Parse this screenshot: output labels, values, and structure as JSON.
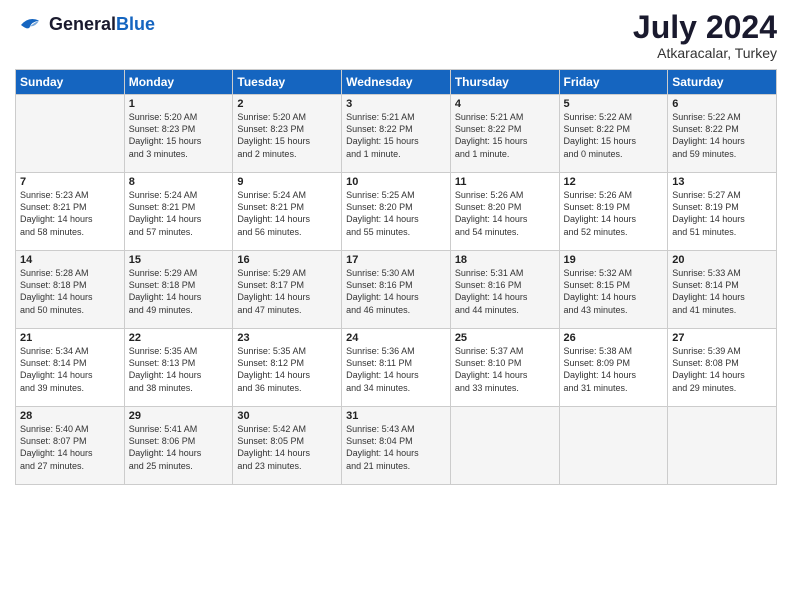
{
  "header": {
    "logo_general": "General",
    "logo_blue": "Blue",
    "month_title": "July 2024",
    "subtitle": "Atkaracalar, Turkey"
  },
  "weekdays": [
    "Sunday",
    "Monday",
    "Tuesday",
    "Wednesday",
    "Thursday",
    "Friday",
    "Saturday"
  ],
  "weeks": [
    [
      {
        "day": "",
        "info": ""
      },
      {
        "day": "1",
        "info": "Sunrise: 5:20 AM\nSunset: 8:23 PM\nDaylight: 15 hours\nand 3 minutes."
      },
      {
        "day": "2",
        "info": "Sunrise: 5:20 AM\nSunset: 8:23 PM\nDaylight: 15 hours\nand 2 minutes."
      },
      {
        "day": "3",
        "info": "Sunrise: 5:21 AM\nSunset: 8:22 PM\nDaylight: 15 hours\nand 1 minute."
      },
      {
        "day": "4",
        "info": "Sunrise: 5:21 AM\nSunset: 8:22 PM\nDaylight: 15 hours\nand 1 minute."
      },
      {
        "day": "5",
        "info": "Sunrise: 5:22 AM\nSunset: 8:22 PM\nDaylight: 15 hours\nand 0 minutes."
      },
      {
        "day": "6",
        "info": "Sunrise: 5:22 AM\nSunset: 8:22 PM\nDaylight: 14 hours\nand 59 minutes."
      }
    ],
    [
      {
        "day": "7",
        "info": "Sunrise: 5:23 AM\nSunset: 8:21 PM\nDaylight: 14 hours\nand 58 minutes."
      },
      {
        "day": "8",
        "info": "Sunrise: 5:24 AM\nSunset: 8:21 PM\nDaylight: 14 hours\nand 57 minutes."
      },
      {
        "day": "9",
        "info": "Sunrise: 5:24 AM\nSunset: 8:21 PM\nDaylight: 14 hours\nand 56 minutes."
      },
      {
        "day": "10",
        "info": "Sunrise: 5:25 AM\nSunset: 8:20 PM\nDaylight: 14 hours\nand 55 minutes."
      },
      {
        "day": "11",
        "info": "Sunrise: 5:26 AM\nSunset: 8:20 PM\nDaylight: 14 hours\nand 54 minutes."
      },
      {
        "day": "12",
        "info": "Sunrise: 5:26 AM\nSunset: 8:19 PM\nDaylight: 14 hours\nand 52 minutes."
      },
      {
        "day": "13",
        "info": "Sunrise: 5:27 AM\nSunset: 8:19 PM\nDaylight: 14 hours\nand 51 minutes."
      }
    ],
    [
      {
        "day": "14",
        "info": "Sunrise: 5:28 AM\nSunset: 8:18 PM\nDaylight: 14 hours\nand 50 minutes."
      },
      {
        "day": "15",
        "info": "Sunrise: 5:29 AM\nSunset: 8:18 PM\nDaylight: 14 hours\nand 49 minutes."
      },
      {
        "day": "16",
        "info": "Sunrise: 5:29 AM\nSunset: 8:17 PM\nDaylight: 14 hours\nand 47 minutes."
      },
      {
        "day": "17",
        "info": "Sunrise: 5:30 AM\nSunset: 8:16 PM\nDaylight: 14 hours\nand 46 minutes."
      },
      {
        "day": "18",
        "info": "Sunrise: 5:31 AM\nSunset: 8:16 PM\nDaylight: 14 hours\nand 44 minutes."
      },
      {
        "day": "19",
        "info": "Sunrise: 5:32 AM\nSunset: 8:15 PM\nDaylight: 14 hours\nand 43 minutes."
      },
      {
        "day": "20",
        "info": "Sunrise: 5:33 AM\nSunset: 8:14 PM\nDaylight: 14 hours\nand 41 minutes."
      }
    ],
    [
      {
        "day": "21",
        "info": "Sunrise: 5:34 AM\nSunset: 8:14 PM\nDaylight: 14 hours\nand 39 minutes."
      },
      {
        "day": "22",
        "info": "Sunrise: 5:35 AM\nSunset: 8:13 PM\nDaylight: 14 hours\nand 38 minutes."
      },
      {
        "day": "23",
        "info": "Sunrise: 5:35 AM\nSunset: 8:12 PM\nDaylight: 14 hours\nand 36 minutes."
      },
      {
        "day": "24",
        "info": "Sunrise: 5:36 AM\nSunset: 8:11 PM\nDaylight: 14 hours\nand 34 minutes."
      },
      {
        "day": "25",
        "info": "Sunrise: 5:37 AM\nSunset: 8:10 PM\nDaylight: 14 hours\nand 33 minutes."
      },
      {
        "day": "26",
        "info": "Sunrise: 5:38 AM\nSunset: 8:09 PM\nDaylight: 14 hours\nand 31 minutes."
      },
      {
        "day": "27",
        "info": "Sunrise: 5:39 AM\nSunset: 8:08 PM\nDaylight: 14 hours\nand 29 minutes."
      }
    ],
    [
      {
        "day": "28",
        "info": "Sunrise: 5:40 AM\nSunset: 8:07 PM\nDaylight: 14 hours\nand 27 minutes."
      },
      {
        "day": "29",
        "info": "Sunrise: 5:41 AM\nSunset: 8:06 PM\nDaylight: 14 hours\nand 25 minutes."
      },
      {
        "day": "30",
        "info": "Sunrise: 5:42 AM\nSunset: 8:05 PM\nDaylight: 14 hours\nand 23 minutes."
      },
      {
        "day": "31",
        "info": "Sunrise: 5:43 AM\nSunset: 8:04 PM\nDaylight: 14 hours\nand 21 minutes."
      },
      {
        "day": "",
        "info": ""
      },
      {
        "day": "",
        "info": ""
      },
      {
        "day": "",
        "info": ""
      }
    ]
  ]
}
